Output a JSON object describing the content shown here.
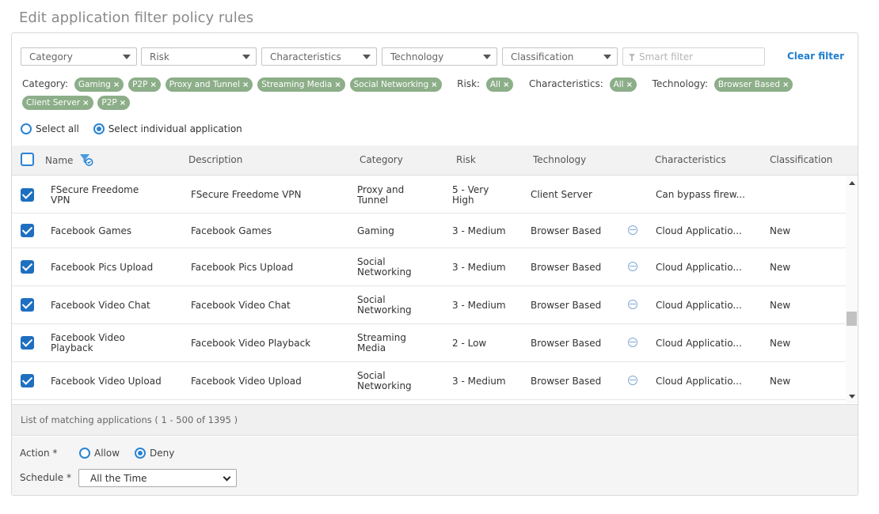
{
  "page": {
    "title": "Edit application filter policy rules"
  },
  "filters": {
    "dropdowns": [
      "Category",
      "Risk",
      "Characteristics",
      "Technology",
      "Classification"
    ],
    "smart_filter_placeholder": "Smart filter",
    "clear_label": "Clear filter"
  },
  "chips": {
    "category_label": "Category:",
    "category": [
      "Gaming",
      "P2P",
      "Proxy and Tunnel",
      "Streaming Media",
      "Social Networking",
      "P2P"
    ],
    "risk_label": "Risk:",
    "risk": [
      "All"
    ],
    "characteristics_label": "Characteristics:",
    "characteristics": [
      "All"
    ],
    "technology_label": "Technology:",
    "technology": [
      "Browser Based",
      "Client Server"
    ],
    "remove_glyph": "×"
  },
  "selection": {
    "select_all": "Select all",
    "select_individual": "Select individual application"
  },
  "table": {
    "headers": [
      "Name",
      "Description",
      "Category",
      "Risk",
      "Technology",
      "Characteristics",
      "Classification"
    ],
    "rows": [
      {
        "name": [
          "FSecure Freedome",
          "VPN"
        ],
        "description": "FSecure Freedome VPN",
        "category": [
          "Proxy and",
          "Tunnel"
        ],
        "risk": [
          "5 - Very",
          "High"
        ],
        "technology": "Client Server",
        "globe": false,
        "characteristics": "Can bypass firew...",
        "classification": ""
      },
      {
        "name": [
          "Facebook Games"
        ],
        "description": "Facebook Games",
        "category": [
          "Gaming"
        ],
        "risk": [
          "3 - Medium"
        ],
        "technology": "Browser Based",
        "globe": true,
        "characteristics": "Cloud Applicatio...",
        "classification": "New"
      },
      {
        "name": [
          "Facebook Pics Upload"
        ],
        "description": "Facebook Pics Upload",
        "category": [
          "Social",
          "Networking"
        ],
        "risk": [
          "3 - Medium"
        ],
        "technology": "Browser Based",
        "globe": true,
        "characteristics": "Cloud Applicatio...",
        "classification": "New"
      },
      {
        "name": [
          "Facebook Video Chat"
        ],
        "description": "Facebook Video Chat",
        "category": [
          "Social",
          "Networking"
        ],
        "risk": [
          "3 - Medium"
        ],
        "technology": "Browser Based",
        "globe": true,
        "characteristics": "Cloud Applicatio...",
        "classification": "New"
      },
      {
        "name": [
          "Facebook Video",
          "Playback"
        ],
        "description": "Facebook Video Playback",
        "category": [
          "Streaming",
          "Media"
        ],
        "risk": [
          "2 - Low"
        ],
        "technology": "Browser Based",
        "globe": true,
        "characteristics": "Cloud Applicatio...",
        "classification": "New"
      },
      {
        "name": [
          "Facebook Video Upload"
        ],
        "description": "Facebook Video Upload",
        "category": [
          "Social",
          "Networking"
        ],
        "risk": [
          "3 - Medium"
        ],
        "technology": "Browser Based",
        "globe": true,
        "characteristics": "Cloud Applicatio...",
        "classification": "New"
      }
    ]
  },
  "list_summary": "List of matching applications ( 1 - 500 of 1395 )",
  "action": {
    "label": "Action *",
    "allow": "Allow",
    "deny": "Deny",
    "selected": "Deny"
  },
  "schedule": {
    "label": "Schedule *",
    "value": "All the Time"
  },
  "colors": {
    "accent": "#2a84d2",
    "chip": "#8cae88",
    "link": "#1f7fcf"
  }
}
